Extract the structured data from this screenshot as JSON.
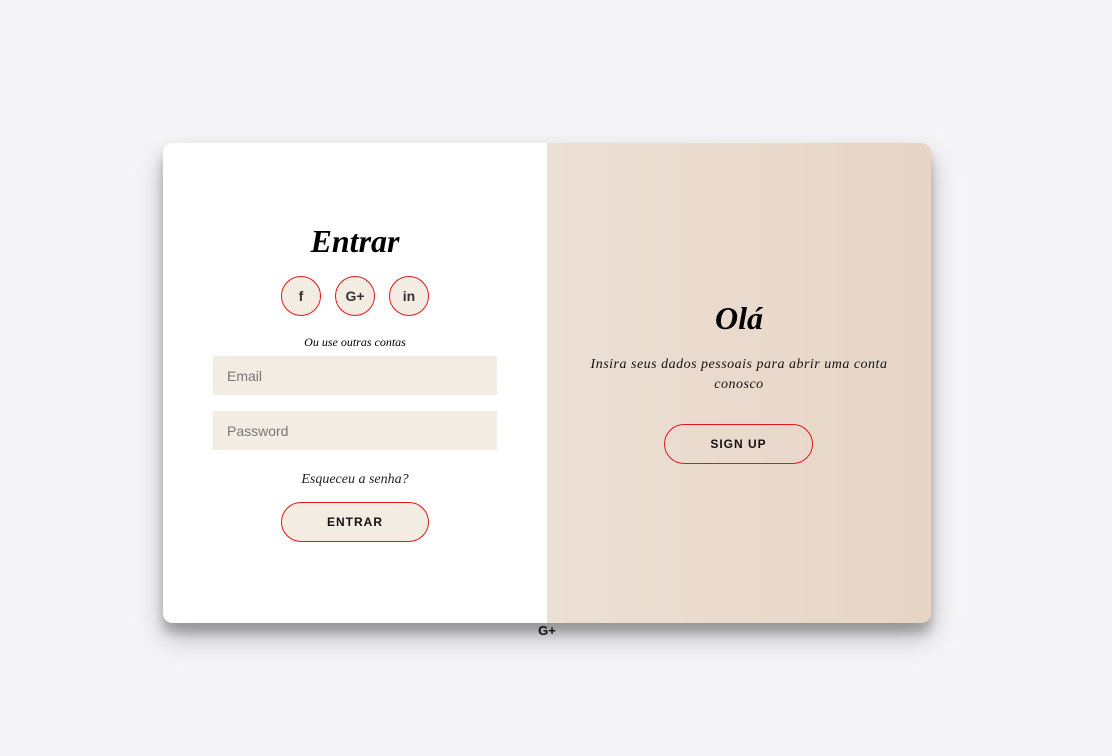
{
  "signin": {
    "title": "Entrar",
    "socials": [
      {
        "icon": "facebook-icon",
        "glyph": "f"
      },
      {
        "icon": "google-plus-icon",
        "glyph": "G+"
      },
      {
        "icon": "linkedin-icon",
        "glyph": "in"
      }
    ],
    "alt_text": "Ou use outras contas",
    "email_placeholder": "Email",
    "email_value": "",
    "password_placeholder": "Password",
    "password_value": "",
    "forgot_label": "Esqueceu a senha?",
    "submit_label": "ENTRAR"
  },
  "overlay": {
    "title": "Olá",
    "description": "Insira seus dados pessoais para abrir uma conta conosco",
    "signup_label": "SIGN UP"
  },
  "floating": {
    "icon": "google-plus-icon",
    "glyph": "G+"
  },
  "colors": {
    "accent": "#e2171b",
    "field_bg": "#f2ece2",
    "overlay_from": "#ecdfd4",
    "overlay_to": "#e7d5c6",
    "page_bg": "#f5f5f7"
  }
}
